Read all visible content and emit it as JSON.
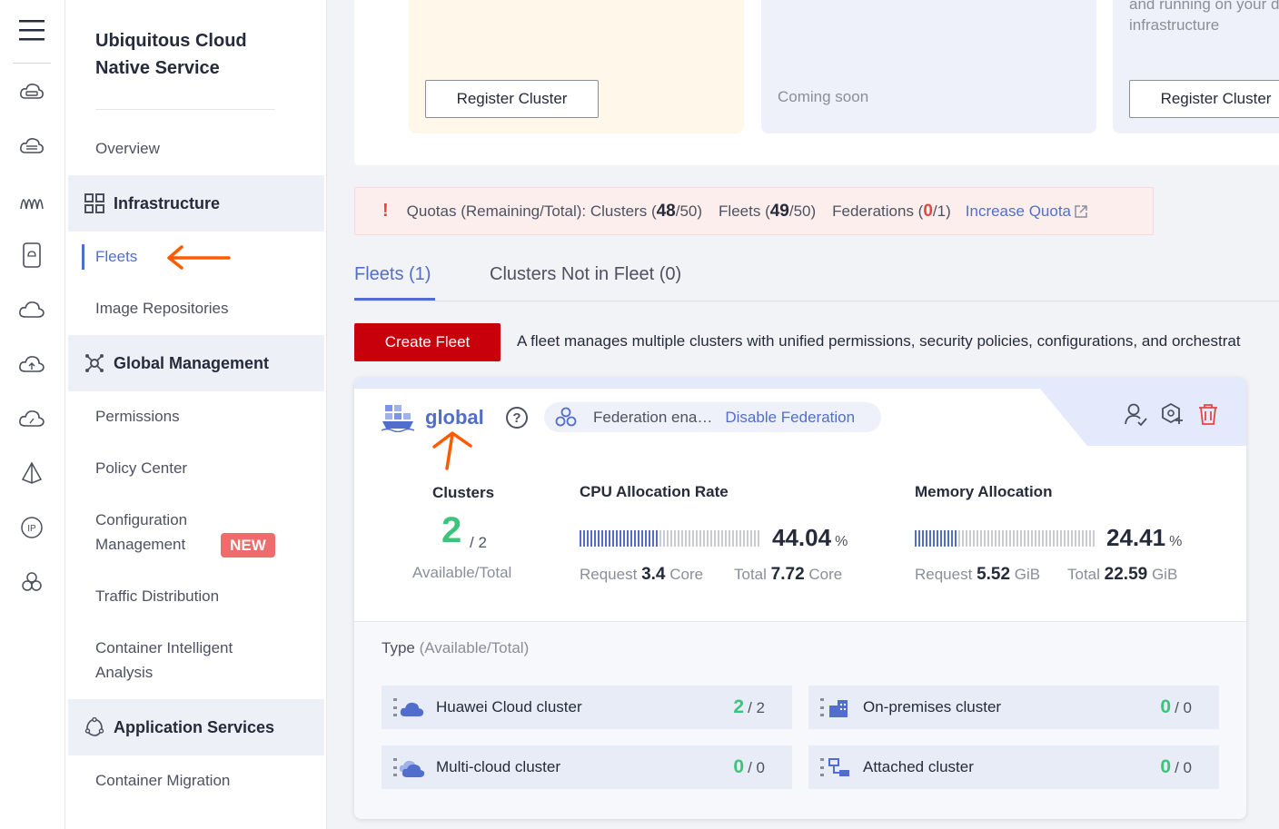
{
  "app": {
    "title": "Ubiquitous Cloud Native Service"
  },
  "rail": {
    "icons": [
      "menu-icon",
      "cloud-drive-icon",
      "cloud-storage-icon",
      "wave-icon",
      "device-icon",
      "cloud-icon",
      "cloud-upload-icon",
      "cloud-gauge-icon",
      "pyramid-icon",
      "ip-icon",
      "cluster-icon"
    ]
  },
  "sidebar": {
    "overview": "Overview",
    "infrastructure": "Infrastructure",
    "fleets": "Fleets",
    "image_repositories": "Image Repositories",
    "global_management": "Global Management",
    "permissions": "Permissions",
    "policy_center": "Policy Center",
    "configuration_management_1": "Configuration",
    "configuration_management_2": "Management",
    "new_badge": "NEW",
    "traffic_distribution": "Traffic Distribution",
    "container_intelligent_analysis_1": "Container Intelligent",
    "container_intelligent_analysis_2": "Analysis",
    "application_services": "Application Services",
    "container_migration": "Container Migration"
  },
  "top_cards": {
    "card_a_button": "Register Cluster",
    "card_b_status": "Coming soon",
    "card_c_text_1": "and running on your data",
    "card_c_text_2": "infrastructure",
    "card_c_button": "Register Cluster"
  },
  "quota": {
    "prefix": "Quotas (Remaining/Total): Clusters (",
    "clusters_remaining": "48",
    "clusters_total_suffix": "/50)",
    "fleets_prefix": "Fleets (",
    "fleets_remaining": "49",
    "fleets_total_suffix": "/50)",
    "federations_prefix": "Federations (",
    "federations_remaining": "0",
    "federations_total_suffix": "/1)",
    "link": "Increase Quota"
  },
  "tabs": [
    {
      "label": "Fleets (1)"
    },
    {
      "label": "Clusters Not in Fleet (0)"
    }
  ],
  "actions": {
    "create_fleet": "Create Fleet",
    "description": "A fleet manages multiple clusters with unified permissions, security policies, configurations, and orchestrat"
  },
  "fleet": {
    "name": "global",
    "help": "?",
    "federation_status": "Federation ena…",
    "disable_federation": "Disable Federation",
    "clusters_title": "Clusters",
    "clusters_available": "2",
    "clusters_total": "/ 2",
    "clusters_caption": "Available/Total",
    "cpu_title": "CPU Allocation Rate",
    "cpu_pct": "44.04",
    "cpu_pct_value": 44.04,
    "pct_unit": "%",
    "cpu_request_label": "Request",
    "cpu_request": "3.4",
    "cpu_unit": "Core",
    "cpu_total_label": "Total",
    "cpu_total": "7.72",
    "mem_title": "Memory Allocation",
    "mem_pct": "24.41",
    "mem_pct_value": 24.41,
    "mem_request_label": "Request",
    "mem_request": "5.52",
    "mem_unit": "GiB",
    "mem_total_label": "Total",
    "mem_total": "22.59",
    "type_label": "Type",
    "type_label_sub": "(Available/Total)",
    "types": [
      {
        "label": "Huawei Cloud cluster",
        "available": "2",
        "total": "/ 2"
      },
      {
        "label": "On-premises cluster",
        "available": "0",
        "total": "/ 0"
      },
      {
        "label": "Multi-cloud cluster",
        "available": "0",
        "total": "/ 0"
      },
      {
        "label": "Attached cluster",
        "available": "0",
        "total": "/ 0"
      }
    ]
  },
  "colors": {
    "accent": "#526ecc",
    "primary_button": "#c7000b",
    "success": "#3dc47c",
    "danger": "#e54545",
    "annotation_arrow": "#ff5a00"
  }
}
